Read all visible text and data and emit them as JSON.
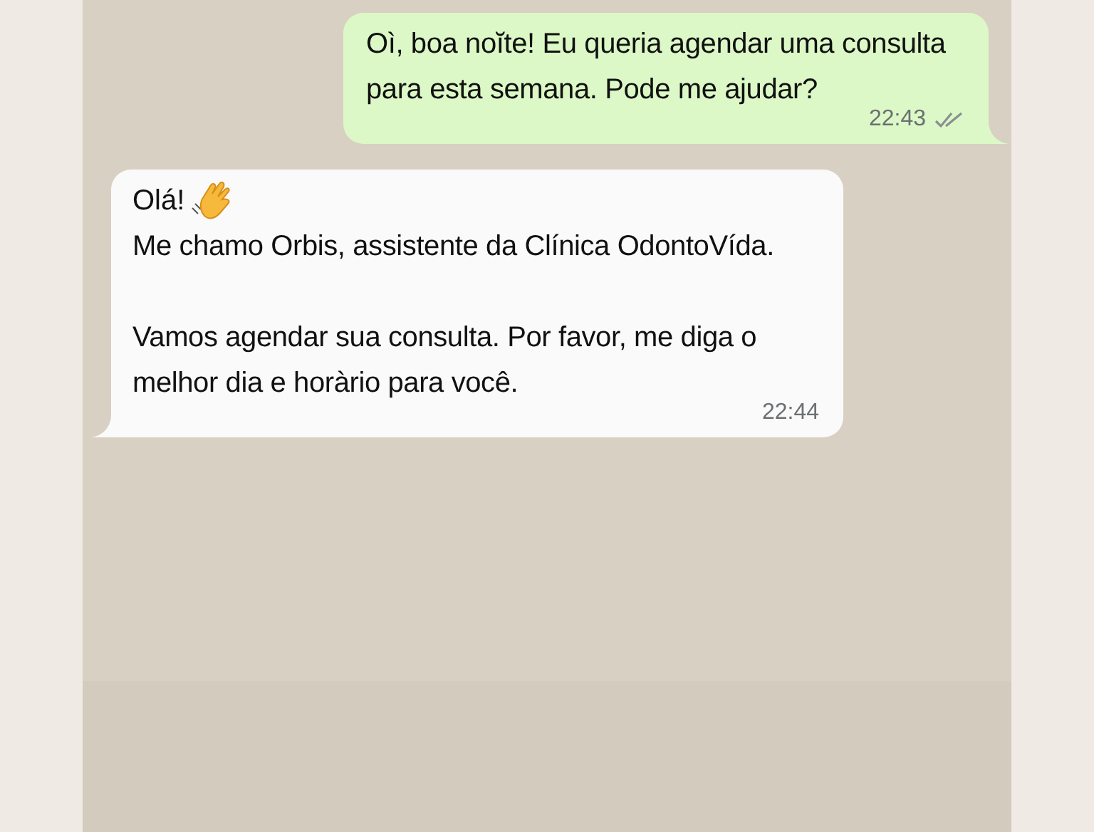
{
  "messages": [
    {
      "kind": "outgoing",
      "paragraphs": [
        "Oì, boa noĭte! Eu queria agendar uma consulta para esta semana. Pode me ajudar?"
      ],
      "time": "22:43",
      "read": false
    },
    {
      "kind": "incoming",
      "greeting": "Olá!",
      "paragraphs": [
        "Me chamo Orbis, assistente da Clínica OdontoVída.",
        "Vamos agendar sua consulta. Por favor, me diga o melhor dia e horàrio para você."
      ],
      "time": "22:44"
    }
  ]
}
